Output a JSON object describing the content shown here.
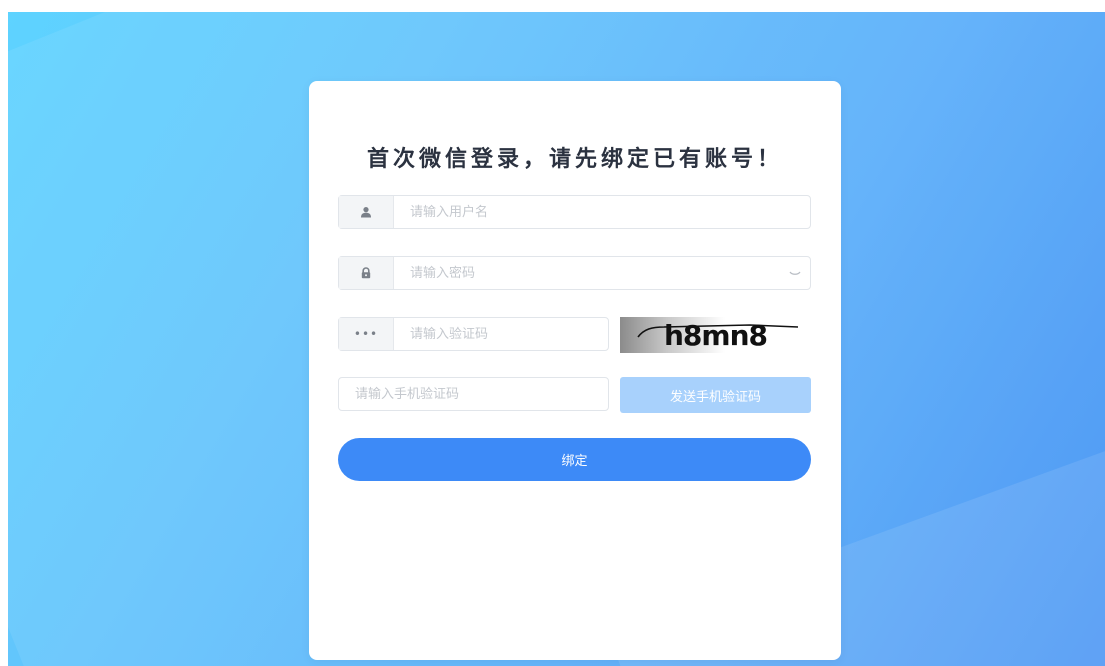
{
  "page": {
    "title": "首次微信登录，请先绑定已有账号！"
  },
  "form": {
    "username": {
      "placeholder": "请输入用户名",
      "icon": "user-icon"
    },
    "password": {
      "placeholder": "请输入密码",
      "icon": "lock-icon",
      "toggle_icon": "eye-closed-icon"
    },
    "captcha": {
      "placeholder": "请输入验证码",
      "icon": "dots-icon",
      "image_text": "h8mn8"
    },
    "sms": {
      "placeholder": "请输入手机验证码"
    },
    "send_sms_label": "发送手机验证码",
    "submit_label": "绑定"
  },
  "colors": {
    "primary": "#3d8af7",
    "send_button_disabled": "#a8d1fc",
    "background_start": "#5ed3ff",
    "background_end": "#3f8ff3"
  }
}
